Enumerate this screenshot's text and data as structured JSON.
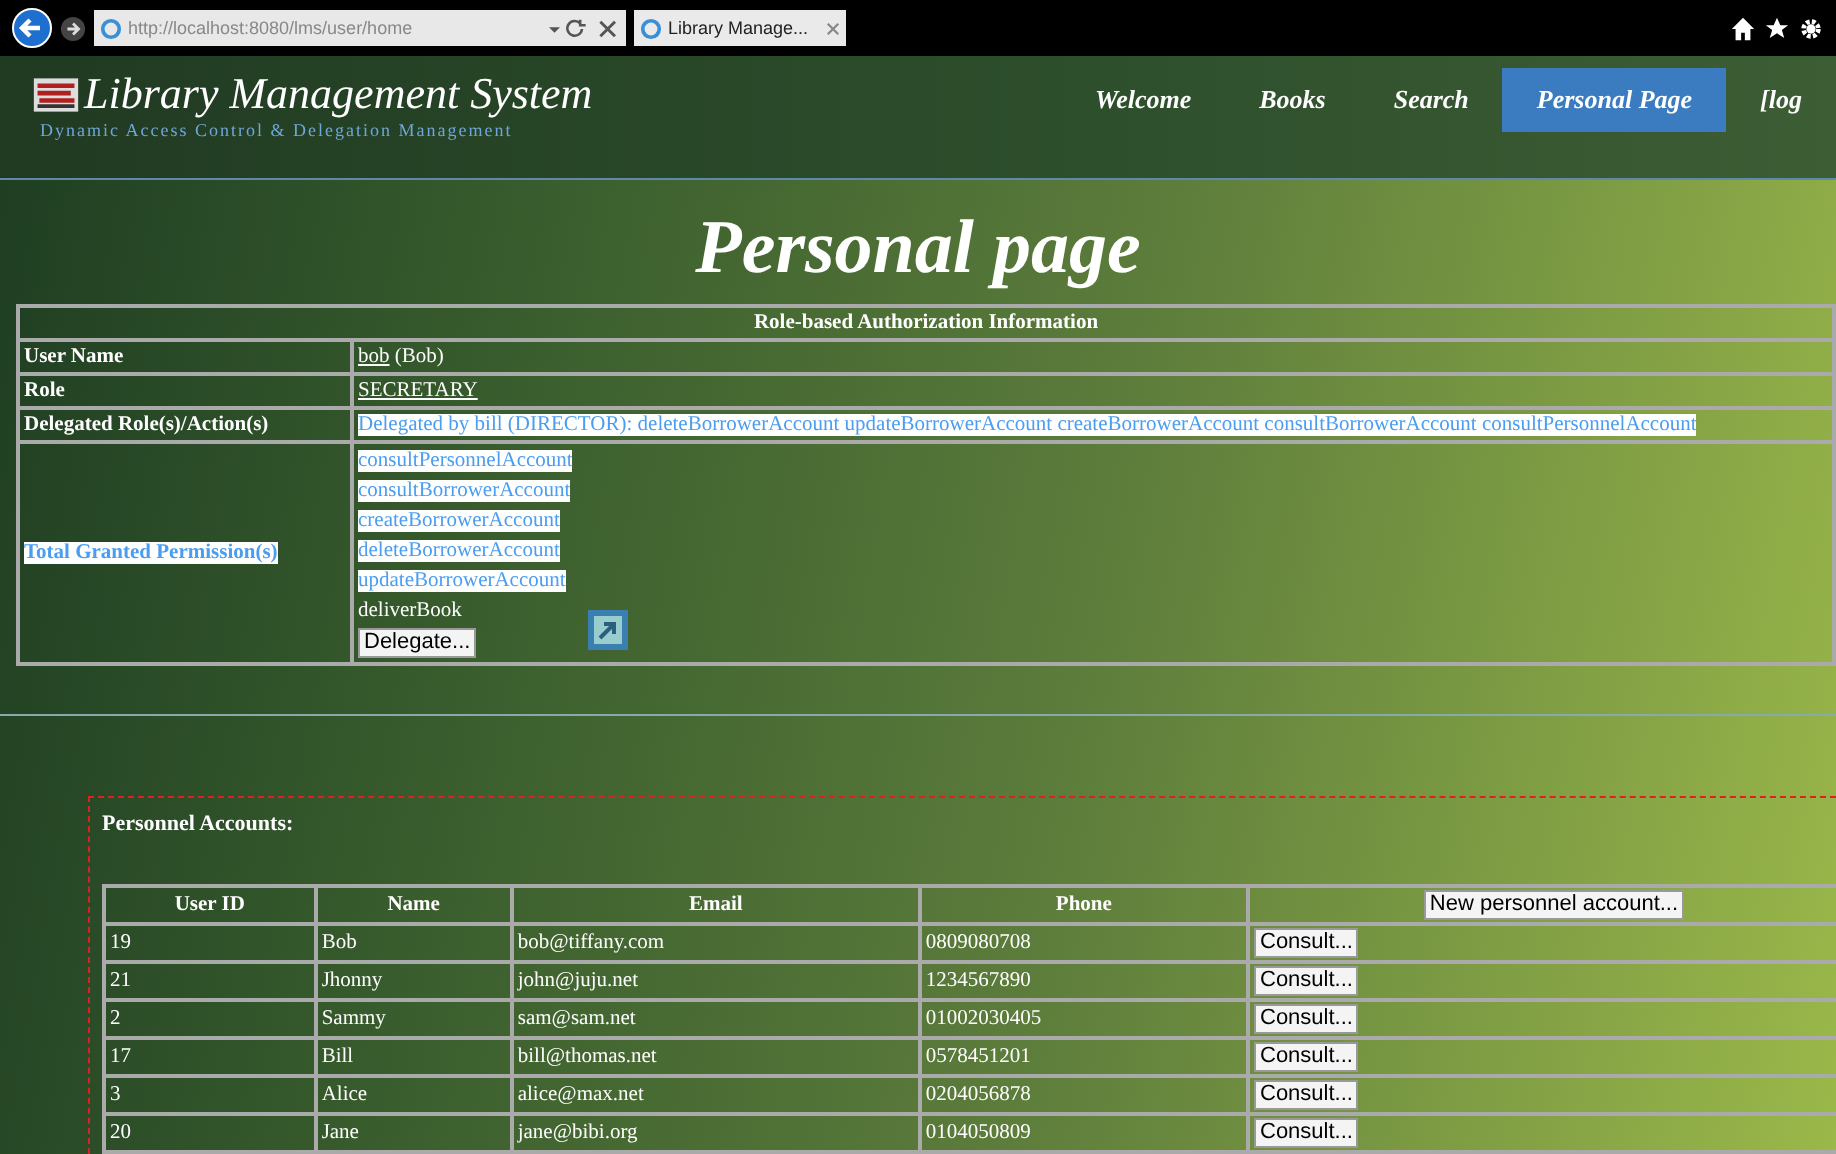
{
  "browser": {
    "address": "http://localhost:8080/lms/user/home",
    "tab_title": "Library Manage..."
  },
  "site": {
    "title": "Library Management System",
    "subtitle": "Dynamic Access Control & Delegation Management"
  },
  "nav": [
    {
      "label": "Welcome",
      "selected": false
    },
    {
      "label": "Books",
      "selected": false
    },
    {
      "label": "Search",
      "selected": false
    },
    {
      "label": "Personal Page",
      "selected": true
    },
    {
      "label": "[log",
      "selected": false
    }
  ],
  "heading": "Personal page",
  "auth_table": {
    "title": "Role-based Authorization Information",
    "user_name_label": "User Name",
    "user_login": "bob",
    "user_full": "(Bob)",
    "role_label": "Role",
    "role": "SECRETARY",
    "delegated_label": "Delegated Role(s)/Action(s)",
    "delegated": "Delegated by bill (DIRECTOR): deleteBorrowerAccount updateBorrowerAccount createBorrowerAccount consultBorrowerAccount consultPersonnelAccount",
    "permissions_label": "Total Granted Permission(s)",
    "permissions": [
      {
        "name": "consultPersonnelAccount",
        "highlighted": true
      },
      {
        "name": "consultBorrowerAccount",
        "highlighted": true
      },
      {
        "name": "createBorrowerAccount",
        "highlighted": true
      },
      {
        "name": "deleteBorrowerAccount",
        "highlighted": true
      },
      {
        "name": "updateBorrowerAccount",
        "highlighted": true
      },
      {
        "name": "deliverBook",
        "highlighted": false
      }
    ],
    "delegate_button": "Delegate..."
  },
  "personnel": {
    "title": "Personnel Accounts:",
    "columns": [
      "User ID",
      "Name",
      "Email",
      "Phone"
    ],
    "new_button": "New personnel account...",
    "rows": [
      {
        "id": "19",
        "name": "Bob",
        "email": "bob@tiffany.com",
        "phone": "0809080708",
        "action": "Consult..."
      },
      {
        "id": "21",
        "name": "Jhonny",
        "email": "john@juju.net",
        "phone": "1234567890",
        "action": "Consult..."
      },
      {
        "id": "2",
        "name": "Sammy",
        "email": "sam@sam.net",
        "phone": "01002030405",
        "action": "Consult..."
      },
      {
        "id": "17",
        "name": "Bill",
        "email": "bill@thomas.net",
        "phone": "0578451201",
        "action": "Consult..."
      },
      {
        "id": "3",
        "name": "Alice",
        "email": "alice@max.net",
        "phone": "0204056878",
        "action": "Consult..."
      },
      {
        "id": "20",
        "name": "Jane",
        "email": "jane@bibi.org",
        "phone": "0104050809",
        "action": "Consult..."
      }
    ]
  }
}
